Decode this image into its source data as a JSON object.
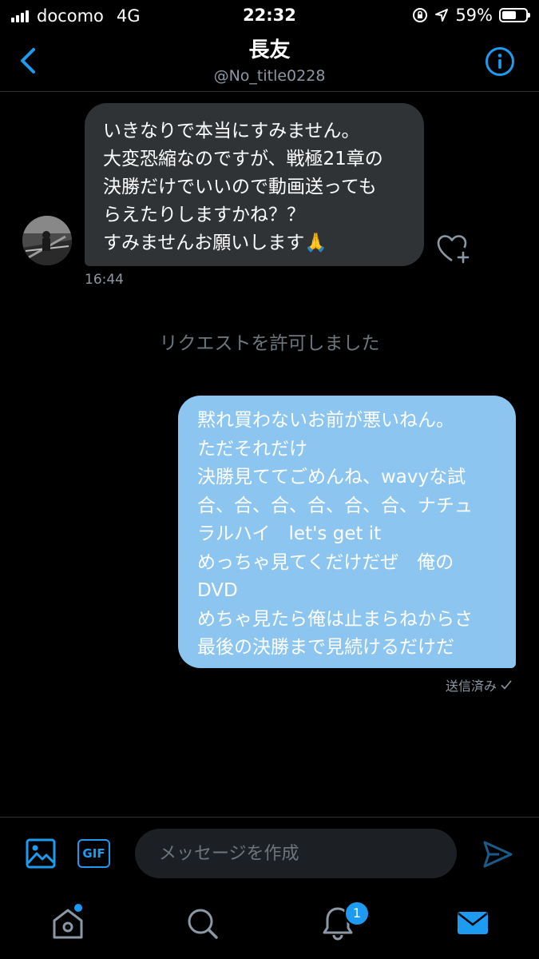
{
  "status_bar": {
    "carrier": "docomo",
    "network": "4G",
    "time": "22:32",
    "battery": "59%",
    "battery_level": 0.59
  },
  "conversation": {
    "name": "長友",
    "handle": "@No_title0228"
  },
  "messages": [
    {
      "direction": "incoming",
      "lines": [
        "いきなりで本当にすみません。",
        "大変恐縮なのですが、戦極21章の",
        "決勝だけでいいので動画送っても",
        "らえたりしますかね？？",
        "すみませんお願いします🙏"
      ],
      "time": "16:44"
    },
    {
      "direction": "outgoing",
      "lines": [
        "黙れ買わないお前が悪いねん。",
        "ただそれだけ",
        "決勝見ててごめんね、wavyな試",
        "合、合、合、合、合、合、ナチュ",
        "ラルハイ　let's get it",
        "めっちゃ見てくだけだぜ　俺の",
        "DVD",
        "めちゃ見たら俺は止まらねからさ",
        "最後の決勝まで見続けるだけだ"
      ],
      "status": "送信済み"
    }
  ],
  "system_notice": "リクエストを許可しました",
  "composer": {
    "gif_label": "GIF",
    "placeholder": "メッセージを作成"
  },
  "tab_bar": {
    "notifications_badge": "1"
  },
  "colors": {
    "accent": "#1d9bf0",
    "incoming_bubble": "#2f3336",
    "outgoing_bubble": "#8cc6f0",
    "background": "#000000"
  }
}
